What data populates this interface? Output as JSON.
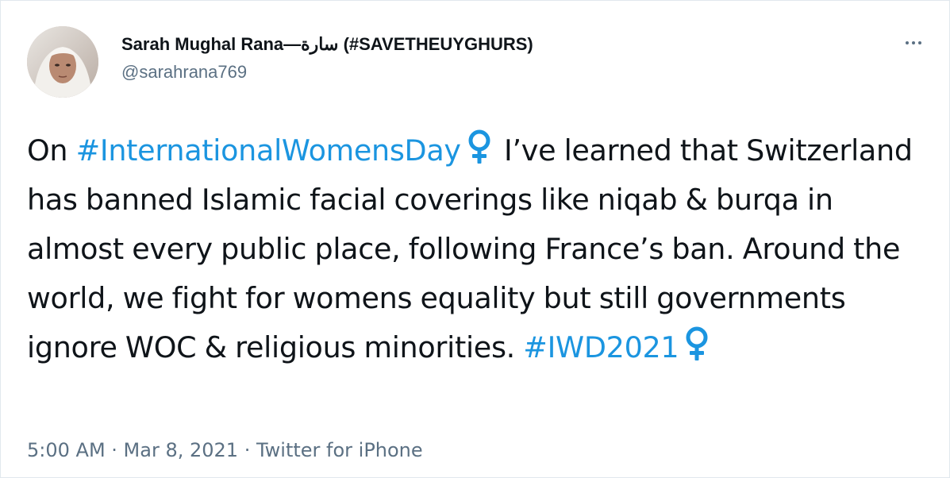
{
  "tweet": {
    "author": {
      "display_name": "Sarah Mughal Rana—سارة (#SAVETHEUYGHURS)",
      "handle": "@sarahrana769"
    },
    "text": {
      "p1": "On ",
      "h1": "#InternationalWomensDay",
      "p2": " I’ve learned that Switzerland has banned Islamic facial coverings like niqab & burqa in almost every public place, following France’s ban. Around the world, we fight for womens equality but still governments ignore WOC & religious minorities. ",
      "h2": "#IWD2021"
    },
    "meta": {
      "time": "5:00 AM",
      "separator1": " · ",
      "date": "Mar 8, 2021",
      "separator2": " · ",
      "source": "Twitter for iPhone"
    },
    "icons": {
      "more": "more-options-icon",
      "emoji": "female-sign-emoji-icon"
    },
    "colors": {
      "hashtag": "#1b95e0",
      "emoji": "#1b95e0",
      "secondary_text": "#5b7083",
      "primary_text": "#0f1419"
    }
  }
}
